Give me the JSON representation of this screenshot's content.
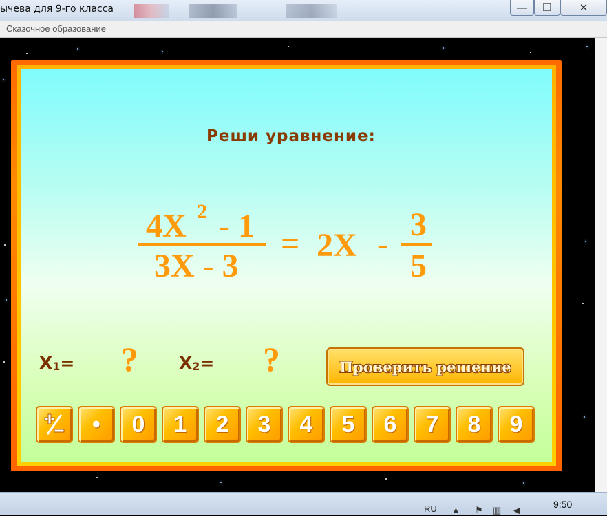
{
  "window": {
    "title": "ычева для 9-го класса",
    "minimize_glyph": "—",
    "maximize_glyph": "❐",
    "close_glyph": "✕"
  },
  "menubar": {
    "label": "Сказочное образование"
  },
  "task": {
    "heading": "Реши уравнение:"
  },
  "equation": {
    "lhs_numerator": "4X",
    "lhs_exponent": "2",
    "lhs_numerator_tail": "- 1",
    "lhs_denominator": "3X - 3",
    "equals": "=",
    "rhs_term": "2X",
    "rhs_minus": "-",
    "rhs_frac_numerator": "3",
    "rhs_frac_denominator": "5"
  },
  "answers": {
    "x1_label": "X",
    "x1_sub": "1",
    "x1_eq": "=",
    "x1_value": "?",
    "x2_label": "X",
    "x2_sub": "2",
    "x2_eq": "=",
    "x2_value": "?"
  },
  "check_button": {
    "label": "Проверить решение"
  },
  "keypad": {
    "keys": [
      "+/-",
      "•",
      "0",
      "1",
      "2",
      "3",
      "4",
      "5",
      "6",
      "7",
      "8",
      "9"
    ]
  },
  "taskbar": {
    "language": "RU",
    "clock": "9:50"
  },
  "colors": {
    "accent_orange": "#ff9a0a",
    "heading_brown": "#8a3a00",
    "frame_orange": "#ff6a00"
  },
  "icons": [
    "minimize-icon",
    "maximize-icon",
    "close-icon",
    "plus-minus-icon",
    "flag-icon",
    "speaker-icon",
    "network-icon"
  ]
}
